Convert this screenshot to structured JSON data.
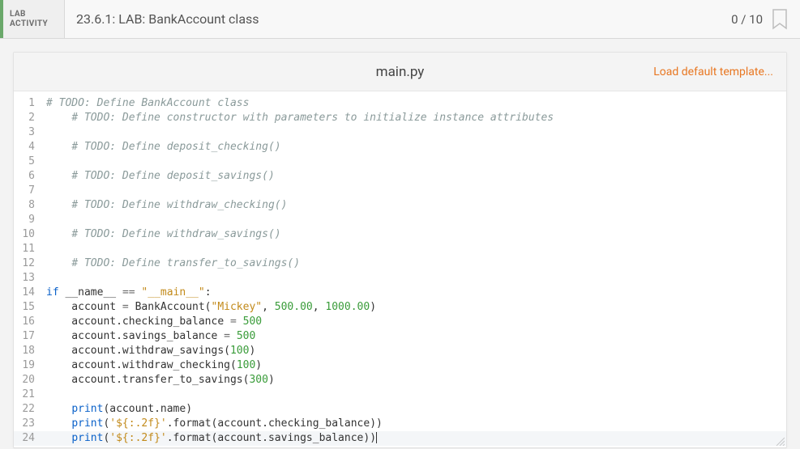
{
  "header": {
    "tab_line1": "LAB",
    "tab_line2": "ACTIVITY",
    "title": "23.6.1: LAB: BankAccount class",
    "score": "0 / 10"
  },
  "editor": {
    "filename": "main.py",
    "load_template_label": "Load default template...",
    "current_line": 24,
    "lines": [
      {
        "n": 1,
        "tokens": [
          {
            "c": "comment",
            "t": "# TODO: Define BankAccount class"
          }
        ]
      },
      {
        "n": 2,
        "tokens": [
          {
            "c": "default",
            "t": "    "
          },
          {
            "c": "comment",
            "t": "# TODO: Define constructor with parameters to initialize instance attributes"
          }
        ]
      },
      {
        "n": 3,
        "tokens": []
      },
      {
        "n": 4,
        "tokens": [
          {
            "c": "default",
            "t": "    "
          },
          {
            "c": "comment",
            "t": "# TODO: Define deposit_checking()"
          }
        ]
      },
      {
        "n": 5,
        "tokens": []
      },
      {
        "n": 6,
        "tokens": [
          {
            "c": "default",
            "t": "    "
          },
          {
            "c": "comment",
            "t": "# TODO: Define deposit_savings()"
          }
        ]
      },
      {
        "n": 7,
        "tokens": []
      },
      {
        "n": 8,
        "tokens": [
          {
            "c": "default",
            "t": "    "
          },
          {
            "c": "comment",
            "t": "# TODO: Define withdraw_checking()"
          }
        ]
      },
      {
        "n": 9,
        "tokens": []
      },
      {
        "n": 10,
        "tokens": [
          {
            "c": "default",
            "t": "    "
          },
          {
            "c": "comment",
            "t": "# TODO: Define withdraw_savings()"
          }
        ]
      },
      {
        "n": 11,
        "tokens": []
      },
      {
        "n": 12,
        "tokens": [
          {
            "c": "default",
            "t": "    "
          },
          {
            "c": "comment",
            "t": "# TODO: Define transfer_to_savings()"
          }
        ]
      },
      {
        "n": 13,
        "tokens": []
      },
      {
        "n": 14,
        "tokens": [
          {
            "c": "keyword",
            "t": "if"
          },
          {
            "c": "default",
            "t": " __name__ "
          },
          {
            "c": "op",
            "t": "=="
          },
          {
            "c": "default",
            "t": " "
          },
          {
            "c": "string",
            "t": "\"__main__\""
          },
          {
            "c": "default",
            "t": ":"
          }
        ]
      },
      {
        "n": 15,
        "tokens": [
          {
            "c": "default",
            "t": "    account "
          },
          {
            "c": "op",
            "t": "="
          },
          {
            "c": "default",
            "t": " BankAccount("
          },
          {
            "c": "string",
            "t": "\"Mickey\""
          },
          {
            "c": "default",
            "t": ", "
          },
          {
            "c": "number",
            "t": "500.00"
          },
          {
            "c": "default",
            "t": ", "
          },
          {
            "c": "number",
            "t": "1000.00"
          },
          {
            "c": "default",
            "t": ")"
          }
        ]
      },
      {
        "n": 16,
        "tokens": [
          {
            "c": "default",
            "t": "    account.checking_balance "
          },
          {
            "c": "op",
            "t": "="
          },
          {
            "c": "default",
            "t": " "
          },
          {
            "c": "number",
            "t": "500"
          }
        ]
      },
      {
        "n": 17,
        "tokens": [
          {
            "c": "default",
            "t": "    account.savings_balance "
          },
          {
            "c": "op",
            "t": "="
          },
          {
            "c": "default",
            "t": " "
          },
          {
            "c": "number",
            "t": "500"
          }
        ]
      },
      {
        "n": 18,
        "tokens": [
          {
            "c": "default",
            "t": "    account.withdraw_savings("
          },
          {
            "c": "number",
            "t": "100"
          },
          {
            "c": "default",
            "t": ")"
          }
        ]
      },
      {
        "n": 19,
        "tokens": [
          {
            "c": "default",
            "t": "    account.withdraw_checking("
          },
          {
            "c": "number",
            "t": "100"
          },
          {
            "c": "default",
            "t": ")"
          }
        ]
      },
      {
        "n": 20,
        "tokens": [
          {
            "c": "default",
            "t": "    account.transfer_to_savings("
          },
          {
            "c": "number",
            "t": "300"
          },
          {
            "c": "default",
            "t": ")"
          }
        ]
      },
      {
        "n": 21,
        "tokens": []
      },
      {
        "n": 22,
        "tokens": [
          {
            "c": "default",
            "t": "    "
          },
          {
            "c": "builtin",
            "t": "print"
          },
          {
            "c": "default",
            "t": "(account.name)"
          }
        ]
      },
      {
        "n": 23,
        "tokens": [
          {
            "c": "default",
            "t": "    "
          },
          {
            "c": "builtin",
            "t": "print"
          },
          {
            "c": "default",
            "t": "("
          },
          {
            "c": "string",
            "t": "'${:.2f}'"
          },
          {
            "c": "default",
            "t": ".format(account.checking_balance))"
          }
        ]
      },
      {
        "n": 24,
        "tokens": [
          {
            "c": "default",
            "t": "    "
          },
          {
            "c": "builtin",
            "t": "print"
          },
          {
            "c": "default",
            "t": "("
          },
          {
            "c": "string",
            "t": "'${:.2f}'"
          },
          {
            "c": "default",
            "t": ".format(account.savings_balance))"
          }
        ]
      }
    ]
  }
}
